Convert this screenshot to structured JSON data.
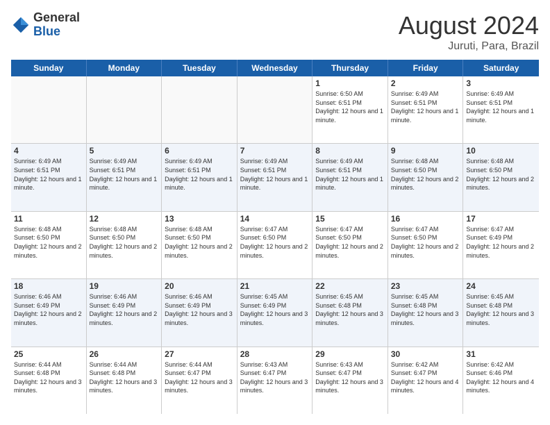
{
  "logo": {
    "general": "General",
    "blue": "Blue"
  },
  "title": "August 2024",
  "location": "Juruti, Para, Brazil",
  "header_days": [
    "Sunday",
    "Monday",
    "Tuesday",
    "Wednesday",
    "Thursday",
    "Friday",
    "Saturday"
  ],
  "weeks": [
    [
      {
        "day": "",
        "info": ""
      },
      {
        "day": "",
        "info": ""
      },
      {
        "day": "",
        "info": ""
      },
      {
        "day": "",
        "info": ""
      },
      {
        "day": "1",
        "info": "Sunrise: 6:50 AM\nSunset: 6:51 PM\nDaylight: 12 hours and 1 minute."
      },
      {
        "day": "2",
        "info": "Sunrise: 6:49 AM\nSunset: 6:51 PM\nDaylight: 12 hours and 1 minute."
      },
      {
        "day": "3",
        "info": "Sunrise: 6:49 AM\nSunset: 6:51 PM\nDaylight: 12 hours and 1 minute."
      }
    ],
    [
      {
        "day": "4",
        "info": "Sunrise: 6:49 AM\nSunset: 6:51 PM\nDaylight: 12 hours and 1 minute."
      },
      {
        "day": "5",
        "info": "Sunrise: 6:49 AM\nSunset: 6:51 PM\nDaylight: 12 hours and 1 minute."
      },
      {
        "day": "6",
        "info": "Sunrise: 6:49 AM\nSunset: 6:51 PM\nDaylight: 12 hours and 1 minute."
      },
      {
        "day": "7",
        "info": "Sunrise: 6:49 AM\nSunset: 6:51 PM\nDaylight: 12 hours and 1 minute."
      },
      {
        "day": "8",
        "info": "Sunrise: 6:49 AM\nSunset: 6:51 PM\nDaylight: 12 hours and 1 minute."
      },
      {
        "day": "9",
        "info": "Sunrise: 6:48 AM\nSunset: 6:50 PM\nDaylight: 12 hours and 2 minutes."
      },
      {
        "day": "10",
        "info": "Sunrise: 6:48 AM\nSunset: 6:50 PM\nDaylight: 12 hours and 2 minutes."
      }
    ],
    [
      {
        "day": "11",
        "info": "Sunrise: 6:48 AM\nSunset: 6:50 PM\nDaylight: 12 hours and 2 minutes."
      },
      {
        "day": "12",
        "info": "Sunrise: 6:48 AM\nSunset: 6:50 PM\nDaylight: 12 hours and 2 minutes."
      },
      {
        "day": "13",
        "info": "Sunrise: 6:48 AM\nSunset: 6:50 PM\nDaylight: 12 hours and 2 minutes."
      },
      {
        "day": "14",
        "info": "Sunrise: 6:47 AM\nSunset: 6:50 PM\nDaylight: 12 hours and 2 minutes."
      },
      {
        "day": "15",
        "info": "Sunrise: 6:47 AM\nSunset: 6:50 PM\nDaylight: 12 hours and 2 minutes."
      },
      {
        "day": "16",
        "info": "Sunrise: 6:47 AM\nSunset: 6:50 PM\nDaylight: 12 hours and 2 minutes."
      },
      {
        "day": "17",
        "info": "Sunrise: 6:47 AM\nSunset: 6:49 PM\nDaylight: 12 hours and 2 minutes."
      }
    ],
    [
      {
        "day": "18",
        "info": "Sunrise: 6:46 AM\nSunset: 6:49 PM\nDaylight: 12 hours and 2 minutes."
      },
      {
        "day": "19",
        "info": "Sunrise: 6:46 AM\nSunset: 6:49 PM\nDaylight: 12 hours and 2 minutes."
      },
      {
        "day": "20",
        "info": "Sunrise: 6:46 AM\nSunset: 6:49 PM\nDaylight: 12 hours and 3 minutes."
      },
      {
        "day": "21",
        "info": "Sunrise: 6:45 AM\nSunset: 6:49 PM\nDaylight: 12 hours and 3 minutes."
      },
      {
        "day": "22",
        "info": "Sunrise: 6:45 AM\nSunset: 6:48 PM\nDaylight: 12 hours and 3 minutes."
      },
      {
        "day": "23",
        "info": "Sunrise: 6:45 AM\nSunset: 6:48 PM\nDaylight: 12 hours and 3 minutes."
      },
      {
        "day": "24",
        "info": "Sunrise: 6:45 AM\nSunset: 6:48 PM\nDaylight: 12 hours and 3 minutes."
      }
    ],
    [
      {
        "day": "25",
        "info": "Sunrise: 6:44 AM\nSunset: 6:48 PM\nDaylight: 12 hours and 3 minutes."
      },
      {
        "day": "26",
        "info": "Sunrise: 6:44 AM\nSunset: 6:48 PM\nDaylight: 12 hours and 3 minutes."
      },
      {
        "day": "27",
        "info": "Sunrise: 6:44 AM\nSunset: 6:47 PM\nDaylight: 12 hours and 3 minutes."
      },
      {
        "day": "28",
        "info": "Sunrise: 6:43 AM\nSunset: 6:47 PM\nDaylight: 12 hours and 3 minutes."
      },
      {
        "day": "29",
        "info": "Sunrise: 6:43 AM\nSunset: 6:47 PM\nDaylight: 12 hours and 3 minutes."
      },
      {
        "day": "30",
        "info": "Sunrise: 6:42 AM\nSunset: 6:47 PM\nDaylight: 12 hours and 4 minutes."
      },
      {
        "day": "31",
        "info": "Sunrise: 6:42 AM\nSunset: 6:46 PM\nDaylight: 12 hours and 4 minutes."
      }
    ]
  ]
}
